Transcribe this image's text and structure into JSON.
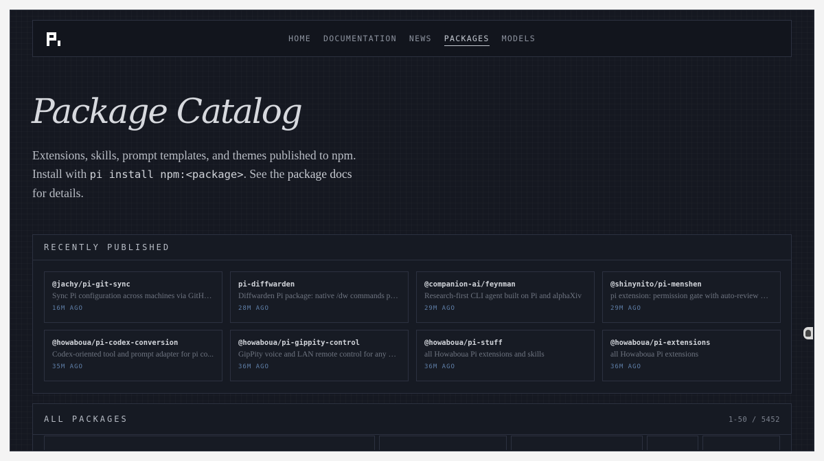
{
  "nav": {
    "links": [
      {
        "label": "HOME"
      },
      {
        "label": "DOCUMENTATION"
      },
      {
        "label": "NEWS"
      },
      {
        "label": "PACKAGES",
        "active": true
      },
      {
        "label": "MODELS"
      }
    ]
  },
  "hero": {
    "title": "Package Catalog",
    "desc_before": "Extensions, skills, prompt templates, and themes published to npm. Install with ",
    "command": "pi install npm:<package>",
    "desc_mid": ". See the ",
    "docs_link": "package docs",
    "desc_after": " for details."
  },
  "recent": {
    "title": "RECENTLY PUBLISHED",
    "cards": [
      {
        "name": "@jachy/pi-git-sync",
        "desc": "Sync Pi configuration across machines via GitHub ...",
        "time": "16M AGO"
      },
      {
        "name": "pi-diffwarden",
        "desc": "Diffwarden Pi package: native /dw commands plus...",
        "time": "28M AGO"
      },
      {
        "name": "@companion-ai/feynman",
        "desc": "Research-first CLI agent built on Pi and alphaXiv",
        "time": "29M AGO"
      },
      {
        "name": "@shinynito/pi-menshen",
        "desc": "pi extension: permission gate with auto-review mo...",
        "time": "29M AGO"
      },
      {
        "name": "@howaboua/pi-codex-conversion",
        "desc": "Codex-oriented tool and prompt adapter for pi co...",
        "time": "35M AGO"
      },
      {
        "name": "@howaboua/pi-gippity-control",
        "desc": "GipPity voice and LAN remote control for any Pi ...",
        "time": "36M AGO"
      },
      {
        "name": "@howaboua/pi-stuff",
        "desc": "all Howaboua Pi extensions and skills",
        "time": "36M AGO"
      },
      {
        "name": "@howaboua/pi-extensions",
        "desc": "all Howaboua Pi extensions",
        "time": "36M AGO"
      }
    ]
  },
  "all": {
    "title": "ALL PACKAGES",
    "count": "1-50 / 5452"
  },
  "colors": {
    "background": "#151821",
    "accent_time": "#5f7fa8",
    "border": "#2c3140"
  }
}
